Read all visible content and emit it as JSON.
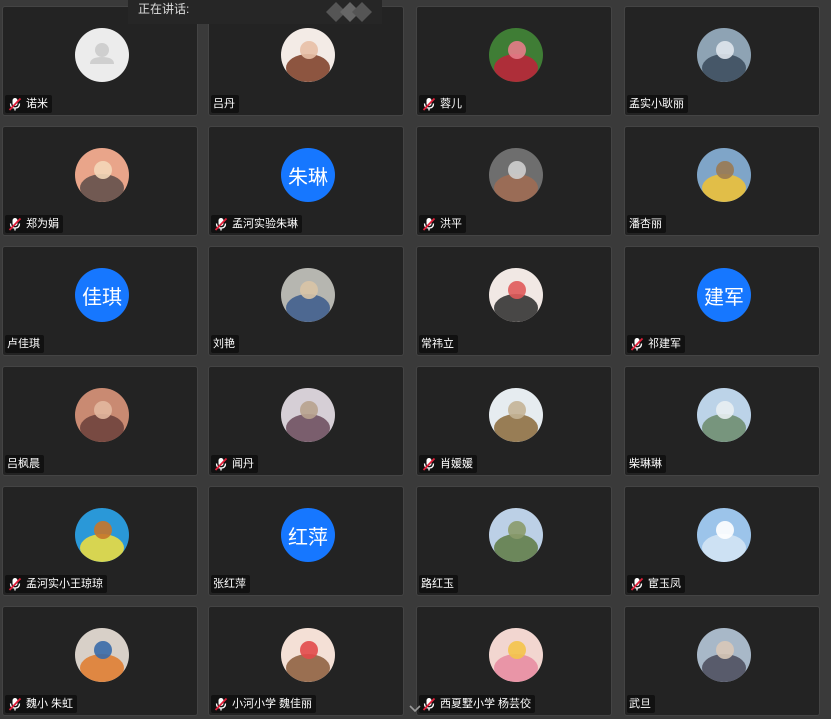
{
  "speaking_label": "正在讲话:",
  "participants": [
    {
      "name": "诺米",
      "muted": true,
      "avatar": {
        "kind": "default"
      }
    },
    {
      "name": "吕丹",
      "muted": false,
      "avatar": {
        "kind": "photo",
        "colors": [
          "#f3ebe6",
          "#7a3b22",
          "#e8c0a6"
        ]
      }
    },
    {
      "name": "蓉儿",
      "muted": true,
      "avatar": {
        "kind": "photo",
        "colors": [
          "#3f7d35",
          "#c2203a",
          "#e57c88"
        ]
      }
    },
    {
      "name": "孟实小耿丽",
      "muted": false,
      "avatar": {
        "kind": "photo",
        "colors": [
          "#8ea3b4",
          "#3a4a5a",
          "#dfe6ec"
        ]
      }
    },
    {
      "name": "郑为娟",
      "muted": true,
      "avatar": {
        "kind": "photo",
        "colors": [
          "#e9a58a",
          "#5c4b48",
          "#f4d7b8"
        ]
      }
    },
    {
      "name": "孟河实验朱琳",
      "muted": true,
      "avatar": {
        "kind": "text",
        "text": "朱琳"
      }
    },
    {
      "name": "洪平",
      "muted": true,
      "avatar": {
        "kind": "photo",
        "colors": [
          "#6e6e6e",
          "#a26c52",
          "#cfcfcf"
        ]
      }
    },
    {
      "name": "潘杏丽",
      "muted": false,
      "avatar": {
        "kind": "photo",
        "colors": [
          "#7fa5c8",
          "#f2c231",
          "#9a7a52"
        ]
      }
    },
    {
      "name": "卢佳琪",
      "muted": false,
      "avatar": {
        "kind": "text",
        "text": "佳琪"
      }
    },
    {
      "name": "刘艳",
      "muted": false,
      "avatar": {
        "kind": "photo",
        "colors": [
          "#b6b6b0",
          "#3b5a8c",
          "#d9c4a6"
        ]
      }
    },
    {
      "name": "常祎立",
      "muted": false,
      "avatar": {
        "kind": "photo",
        "colors": [
          "#f1e8e4",
          "#2a2a2a",
          "#e05a5a"
        ]
      }
    },
    {
      "name": "祁建军",
      "muted": true,
      "avatar": {
        "kind": "text",
        "text": "建军"
      }
    },
    {
      "name": "吕枫晨",
      "muted": false,
      "avatar": {
        "kind": "photo",
        "colors": [
          "#c98a72",
          "#6a3e3a",
          "#e2b79e"
        ]
      }
    },
    {
      "name": "闻丹",
      "muted": true,
      "avatar": {
        "kind": "photo",
        "colors": [
          "#d6cfd6",
          "#6a4a5a",
          "#b8a28e"
        ]
      }
    },
    {
      "name": "肖媛媛",
      "muted": true,
      "avatar": {
        "kind": "photo",
        "colors": [
          "#e6ecf0",
          "#8a6a3a",
          "#c4b496"
        ]
      }
    },
    {
      "name": "柴琳琳",
      "muted": false,
      "avatar": {
        "kind": "photo",
        "colors": [
          "#bcd3e8",
          "#6b8a6a",
          "#e8eef2"
        ]
      }
    },
    {
      "name": "孟河实小王琼琼",
      "muted": true,
      "avatar": {
        "kind": "photo",
        "colors": [
          "#2a98d8",
          "#f6df3a",
          "#c6762a"
        ]
      }
    },
    {
      "name": "张红萍",
      "muted": false,
      "avatar": {
        "kind": "text",
        "text": "红萍"
      }
    },
    {
      "name": "路红玉",
      "muted": false,
      "avatar": {
        "kind": "photo",
        "colors": [
          "#bcd0e6",
          "#5e7a42",
          "#8a9a6a"
        ]
      }
    },
    {
      "name": "宦玉凤",
      "muted": true,
      "avatar": {
        "kind": "photo",
        "colors": [
          "#9cc4ea",
          "#d6e6f4",
          "#ffffff"
        ]
      }
    },
    {
      "name": "魏小  朱虹",
      "muted": true,
      "avatar": {
        "kind": "photo",
        "colors": [
          "#d8d0c8",
          "#e07a2a",
          "#3a6aa8"
        ]
      }
    },
    {
      "name": "小河小学 魏佳丽",
      "muted": true,
      "avatar": {
        "kind": "photo",
        "colors": [
          "#f4e0d6",
          "#8a5a3a",
          "#e24a4a"
        ]
      }
    },
    {
      "name": "西夏墅小学 杨芸佼",
      "muted": true,
      "avatar": {
        "kind": "photo",
        "colors": [
          "#f2d6d0",
          "#e88aa0",
          "#f4c44a"
        ]
      }
    },
    {
      "name": "武旦",
      "muted": false,
      "avatar": {
        "kind": "photo",
        "colors": [
          "#a8b8c8",
          "#4a4a5a",
          "#d8c8b8"
        ]
      }
    }
  ]
}
